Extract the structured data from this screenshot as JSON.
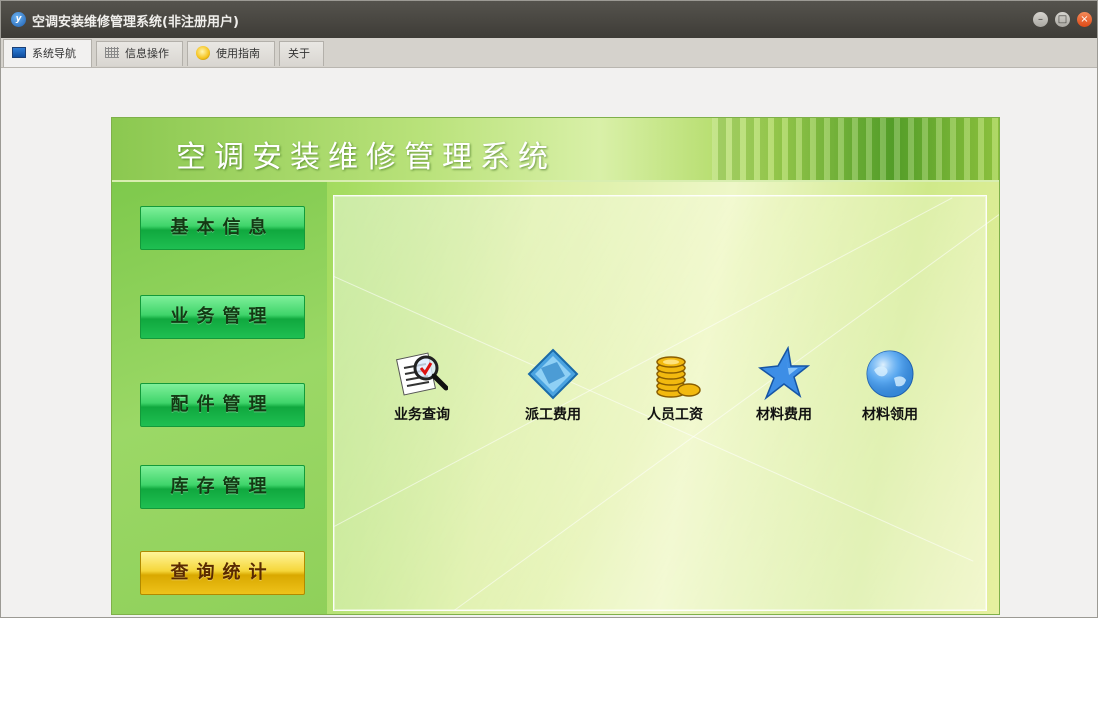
{
  "window": {
    "title": "空调安装维修管理系统(非注册用户)",
    "app_icon_letter": "y",
    "controls": {
      "minimize": "–",
      "maximize": "□",
      "close": "×"
    }
  },
  "tabs": [
    {
      "label": "系统导航",
      "icon": "monitor-icon",
      "active": true
    },
    {
      "label": "信息操作",
      "icon": "grid-icon",
      "active": false
    },
    {
      "label": "使用指南",
      "icon": "bulb-icon",
      "active": false
    },
    {
      "label": "关于",
      "icon": "",
      "active": false
    }
  ],
  "header": {
    "title": "空调安装维修管理系统"
  },
  "sidebar": {
    "buttons": [
      {
        "label": "基本信息"
      },
      {
        "label": "业务管理"
      },
      {
        "label": "配件管理"
      },
      {
        "label": "库存管理"
      },
      {
        "label": "查询统计"
      }
    ]
  },
  "functions": [
    {
      "label": "业务查询",
      "icon": "magnifier-document-icon"
    },
    {
      "label": "派工费用",
      "icon": "blue-diamond-icon"
    },
    {
      "label": "人员工资",
      "icon": "gold-coins-icon"
    },
    {
      "label": "材料费用",
      "icon": "blue-star-icon"
    },
    {
      "label": "材料领用",
      "icon": "globe-icon"
    }
  ],
  "colors": {
    "titlebar": "#3e3c37",
    "nav_green": "#1fbf52",
    "nav_gold": "#eec21a",
    "panel_green": "#8fd05a"
  }
}
